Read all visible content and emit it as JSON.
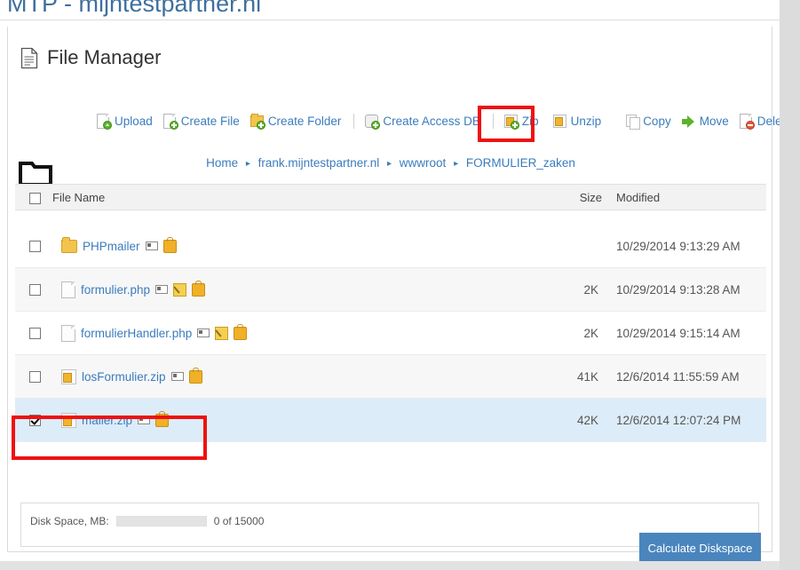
{
  "site": {
    "title": "MTP - mijntestpartner.nl"
  },
  "panel": {
    "heading": "File Manager",
    "heading_icon": "document-icon"
  },
  "toolbar": {
    "items": [
      {
        "label": "Upload",
        "icon": "upload-icon"
      },
      {
        "label": "Create File",
        "icon": "create-file-icon"
      },
      {
        "label": "Create Folder",
        "icon": "create-folder-icon"
      },
      {
        "label": "Create Access DB",
        "icon": "create-access-db-icon"
      },
      {
        "label": "Zip",
        "icon": "zip-icon"
      },
      {
        "label": "Unzip",
        "icon": "unzip-icon"
      },
      {
        "label": "Copy",
        "icon": "copy-icon"
      },
      {
        "label": "Move",
        "icon": "move-icon"
      },
      {
        "label": "Delete",
        "icon": "delete-icon"
      }
    ]
  },
  "breadcrumb": {
    "separator": "▸",
    "items": [
      "Home",
      "frank.mijntestpartner.nl",
      "wwwroot",
      "FORMULIER_zaken"
    ]
  },
  "navigation": {
    "up_folder_icon": "folder-up-icon"
  },
  "table": {
    "headers": {
      "name": "File Name",
      "size": "Size",
      "modified": "Modified"
    },
    "rows": [
      {
        "name": "PHPmailer",
        "type_icon": "folder-icon",
        "size": "",
        "modified": "10/29/2014 9:13:29 AM",
        "checked": false,
        "actions": [
          "rename-icon",
          "lock-icon"
        ]
      },
      {
        "name": "formulier.php",
        "type_icon": "file-icon",
        "size": "2K",
        "modified": "10/29/2014 9:13:28 AM",
        "checked": false,
        "actions": [
          "rename-icon",
          "edit-icon",
          "lock-icon"
        ]
      },
      {
        "name": "formulierHandler.php",
        "type_icon": "file-icon",
        "size": "2K",
        "modified": "10/29/2014 9:15:14 AM",
        "checked": false,
        "actions": [
          "rename-icon",
          "edit-icon",
          "lock-icon"
        ]
      },
      {
        "name": "losFormulier.zip",
        "type_icon": "zip-icon",
        "size": "41K",
        "modified": "12/6/2014 11:55:59 AM",
        "checked": false,
        "actions": [
          "rename-icon",
          "lock-icon"
        ]
      },
      {
        "name": "mailer.zip",
        "type_icon": "zip-icon",
        "size": "42K",
        "modified": "12/6/2014 12:07:24 PM",
        "checked": true,
        "actions": [
          "rename-icon",
          "lock-icon"
        ]
      }
    ]
  },
  "footer": {
    "disk_label": "Disk Space, MB:",
    "disk_usage": "0 of 15000",
    "disk_percent": 0,
    "calculate_button": "Calculate Diskspace"
  },
  "annotations": [
    {
      "name": "unzip-highlight",
      "color": "#ee1111",
      "target": "Unzip"
    },
    {
      "name": "mailer-highlight",
      "color": "#ee1111",
      "target": "mailer.zip"
    }
  ],
  "colors": {
    "link": "#3a7cbd",
    "selected_row": "#ddecf9",
    "button": "#4a85bd",
    "annotation": "#ee1111"
  }
}
